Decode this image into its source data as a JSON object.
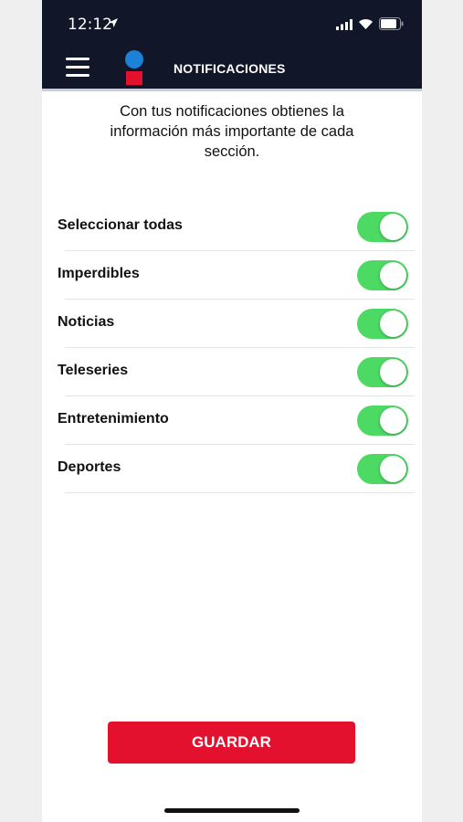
{
  "status_bar": {
    "time": "12:12",
    "icons": [
      "location-arrow-icon",
      "signal-icon",
      "wifi-icon",
      "battery-icon"
    ]
  },
  "header": {
    "title": "NOTIFICACIONES",
    "menu_icon": "hamburger-menu-icon",
    "logo": "brand-logo",
    "background_color": "#111628"
  },
  "intro_text": "Con tus notificaciones obtienes la información más importante de cada sección.",
  "settings": [
    {
      "label": "Seleccionar todas",
      "enabled": true
    },
    {
      "label": "Imperdibles",
      "enabled": true
    },
    {
      "label": "Noticias",
      "enabled": true
    },
    {
      "label": "Teleseries",
      "enabled": true
    },
    {
      "label": "Entretenimiento",
      "enabled": true
    },
    {
      "label": "Deportes",
      "enabled": true
    }
  ],
  "save_button": {
    "label": "GUARDAR"
  },
  "colors": {
    "toggle_on": "#4cd964",
    "accent_red": "#e3102e",
    "logo_blue": "#1b82d8"
  }
}
